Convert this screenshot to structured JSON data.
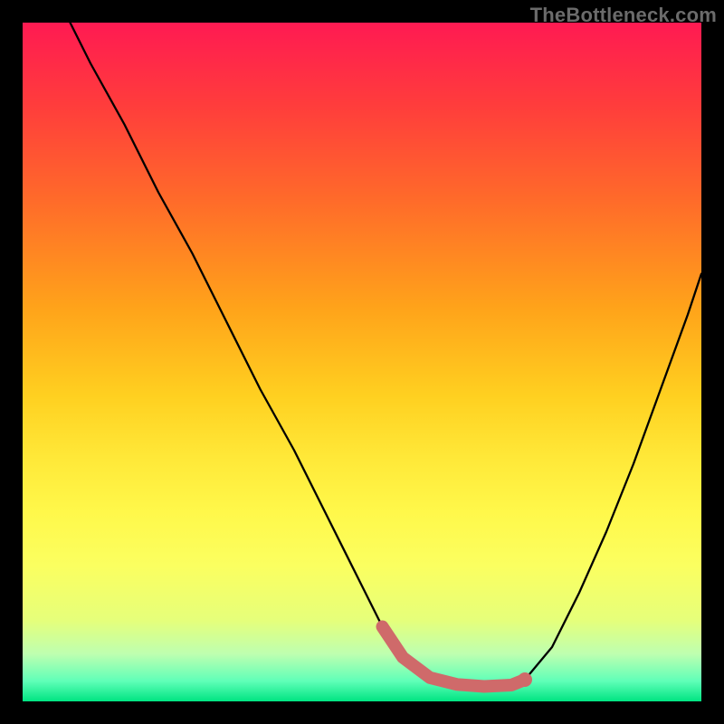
{
  "watermark": "TheBottleneck.com",
  "chart_data": {
    "type": "line",
    "title": "",
    "xlabel": "",
    "ylabel": "",
    "xlim": [
      0,
      100
    ],
    "ylim": [
      0,
      100
    ],
    "series": [
      {
        "name": "curve",
        "x": [
          7,
          10,
          15,
          20,
          25,
          30,
          35,
          40,
          45,
          50,
          53,
          56,
          60,
          64,
          68,
          72,
          74,
          78,
          82,
          86,
          90,
          94,
          98,
          100
        ],
        "values": [
          100,
          94,
          85,
          75,
          66,
          56,
          46,
          37,
          27,
          17,
          11,
          6.5,
          3.5,
          2.5,
          2.2,
          2.4,
          3.2,
          8,
          16,
          25,
          35,
          46,
          57,
          63
        ]
      },
      {
        "name": "highlight-band",
        "x": [
          53,
          56,
          60,
          64,
          68,
          72,
          74
        ],
        "values": [
          11,
          6.5,
          3.5,
          2.5,
          2.2,
          2.4,
          3.2
        ]
      }
    ],
    "colors": {
      "curve": "#000000",
      "highlight": "#cf6a6a"
    }
  }
}
